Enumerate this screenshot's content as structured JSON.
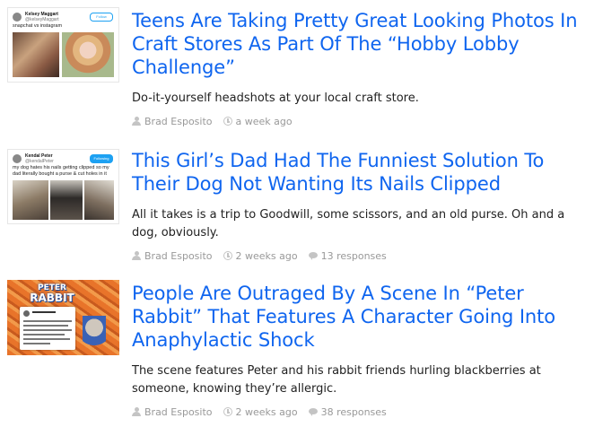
{
  "stories": [
    {
      "headline": "Teens Are Taking Pretty Great Looking Photos In Craft Stores As Part Of The “Hobby Lobby Challenge”",
      "description": "Do-it-yourself headshots at your local craft store.",
      "author": "Brad Esposito",
      "time": "a week ago",
      "responses": "",
      "thumb": {
        "kind": "tweet",
        "name": "Kelsey Maggart",
        "handle": "@kelseyMaggart",
        "follow_label": "Follow",
        "text": "snapchat vs instagram"
      }
    },
    {
      "headline": "This Girl’s Dad Had The Funniest Solution To Their Dog Not Wanting Its Nails Clipped",
      "description": "All it takes is a trip to Goodwill, some scissors, and an old purse. Oh and a dog, obviously.",
      "author": "Brad Esposito",
      "time": "2 weeks ago",
      "responses": "13 responses",
      "thumb": {
        "kind": "tweet",
        "name": "Kendal Peter",
        "handle": "@kendalPeter",
        "follow_label": "Following",
        "text": "my dog hates his nails getting clipped so my dad literally bought a purse & cut holes in it"
      }
    },
    {
      "headline": "People Are Outraged By A Scene In “Peter Rabbit” That Features A Character Going Into Anaphylactic Shock",
      "description": "The scene features Peter and his rabbit friends hurling blackberries at someone, knowing they’re allergic.",
      "author": "Brad Esposito",
      "time": "2 weeks ago",
      "responses": "38 responses",
      "thumb": {
        "kind": "poster",
        "title_top": "PETER",
        "title_bottom": "RABBIT"
      }
    }
  ],
  "colors": {
    "headline": "#0f65ef",
    "meta": "#999999",
    "icon": "#c4c4c4",
    "carrot": "#e8742a"
  }
}
